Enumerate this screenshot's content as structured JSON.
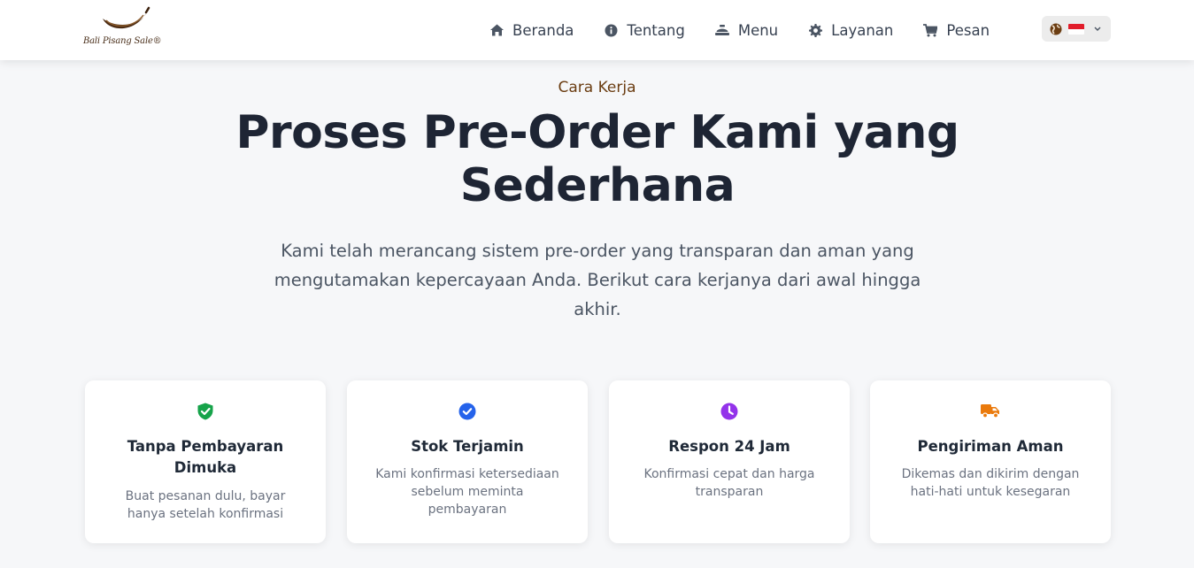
{
  "brand": {
    "logo_text": "Bali Pisang Sale®"
  },
  "nav": {
    "items": [
      {
        "label": "Beranda",
        "icon": "home-icon"
      },
      {
        "label": "Tentang",
        "icon": "info-icon"
      },
      {
        "label": "Menu",
        "icon": "food-tray-icon"
      },
      {
        "label": "Layanan",
        "icon": "gear-icon"
      },
      {
        "label": "Pesan",
        "icon": "cart-icon"
      }
    ],
    "language": {
      "icon": "globe-icon",
      "flag": "indonesia-flag",
      "chevron": "chevron-down-icon"
    }
  },
  "hero": {
    "eyebrow": "Cara Kerja",
    "title": "Proses Pre-Order Kami yang Sederhana",
    "subtitle": "Kami telah merancang sistem pre-order yang transparan dan aman yang mengutamakan kepercayaan Anda. Berikut cara kerjanya dari awal hingga akhir."
  },
  "features": [
    {
      "title": "Tanpa Pembayaran Dimuka",
      "description": "Buat pesanan dulu, bayar hanya setelah konfirmasi",
      "icon": "shield-check-icon",
      "color": "#16a34a"
    },
    {
      "title": "Stok Terjamin",
      "description": "Kami konfirmasi ketersediaan sebelum meminta pembayaran",
      "icon": "check-circle-icon",
      "color": "#2563eb"
    },
    {
      "title": "Respon 24 Jam",
      "description": "Konfirmasi cepat dan harga transparan",
      "icon": "clock-icon",
      "color": "#9333ea"
    },
    {
      "title": "Pengiriman Aman",
      "description": "Dikemas dan dikirim dengan hati-hati untuk kesegaran",
      "icon": "truck-icon",
      "color": "#ea7a0c"
    }
  ],
  "colors": {
    "accent": "#6b3d12",
    "heading": "#1e2534",
    "background": "#f6f7f9"
  }
}
